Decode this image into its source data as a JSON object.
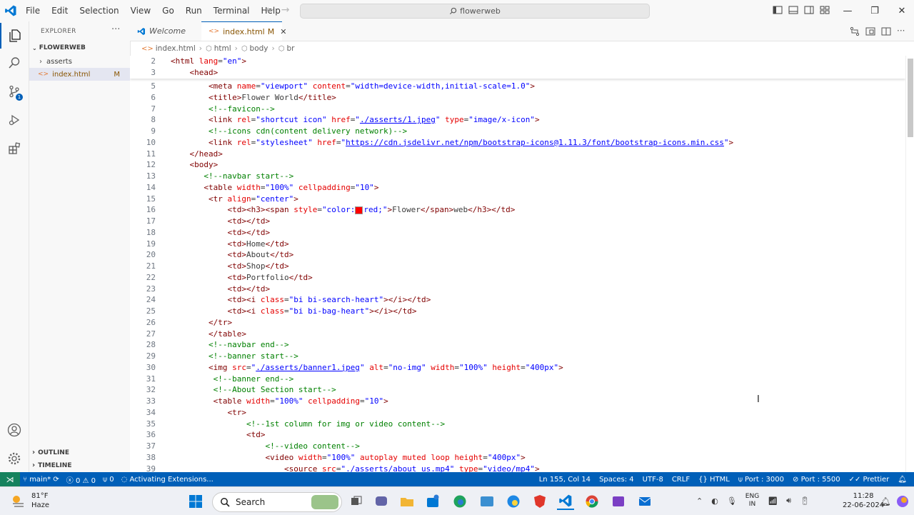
{
  "menu": [
    "File",
    "Edit",
    "Selection",
    "View",
    "Go",
    "Run",
    "Terminal",
    "Help"
  ],
  "command_center": "flowerweb",
  "sidebar": {
    "title": "EXPLORER",
    "folder": "FLOWERWEB",
    "items": [
      {
        "label": "asserts",
        "type": "folder"
      },
      {
        "label": "index.html",
        "badge": "M",
        "type": "file"
      }
    ],
    "outline": "OUTLINE",
    "timeline": "TIMELINE"
  },
  "activity_badge": "1",
  "tabs": [
    {
      "label": "Welcome"
    },
    {
      "label": "index.html",
      "badge": "M"
    }
  ],
  "breadcrumb": [
    "index.html",
    "html",
    "body",
    "br"
  ],
  "lines": [
    {
      "n": "2",
      "code": "<html lang=\"en\">"
    },
    {
      "n": "3",
      "code": "    <head>"
    },
    {
      "n": "5",
      "code": "        <meta name=\"viewport\" content=\"width=device-width,initial-scale=1.0\">"
    },
    {
      "n": "6",
      "code": "        <title>Flower World</title>"
    },
    {
      "n": "7",
      "code": "        <!--favicon-->"
    },
    {
      "n": "8",
      "code": "        <link rel=\"shortcut icon\" href=\"./asserts/1.jpeg\" type=\"image/x-icon\">"
    },
    {
      "n": "9",
      "code": "        <!--icons cdn(content delivery network)-->"
    },
    {
      "n": "10",
      "code": "        <link rel=\"stylesheet\" href=\"https://cdn.jsdelivr.net/npm/bootstrap-icons@1.11.3/font/bootstrap-icons.min.css\">"
    },
    {
      "n": "11",
      "code": "    </head>"
    },
    {
      "n": "12",
      "code": "    <body>"
    },
    {
      "n": "13",
      "code": "       <!--navbar start-->"
    },
    {
      "n": "14",
      "code": "       <table width=\"100%\" cellpadding=\"10\">"
    },
    {
      "n": "15",
      "code": "        <tr align=\"center\">"
    },
    {
      "n": "16",
      "code": "            <td><h3><span style=\"color:■red;\">Flower</span>web</h3></td>"
    },
    {
      "n": "17",
      "code": "            <td></td>"
    },
    {
      "n": "18",
      "code": "            <td></td>"
    },
    {
      "n": "19",
      "code": "            <td>Home</td>"
    },
    {
      "n": "20",
      "code": "            <td>About</td>"
    },
    {
      "n": "21",
      "code": "            <td>Shop</td>"
    },
    {
      "n": "22",
      "code": "            <td>Portfolio</td>"
    },
    {
      "n": "23",
      "code": "            <td></td>"
    },
    {
      "n": "24",
      "code": "            <td><i class=\"bi bi-search-heart\"></i></td>"
    },
    {
      "n": "25",
      "code": "            <td><i class=\"bi bi-bag-heart\"></i></td>"
    },
    {
      "n": "26",
      "code": "        </tr>"
    },
    {
      "n": "27",
      "code": "        </table>"
    },
    {
      "n": "28",
      "code": "        <!--navbar end-->"
    },
    {
      "n": "29",
      "code": "        <!--banner start-->"
    },
    {
      "n": "30",
      "code": "        <img src=\"./asserts/banner1.jpeg\" alt=\"no-img\" width=\"100%\" height=\"400px\">"
    },
    {
      "n": "31",
      "code": "         <!--banner end-->"
    },
    {
      "n": "32",
      "code": "         <!--About Section start-->"
    },
    {
      "n": "33",
      "code": "         <table width=\"100%\" cellpadding=\"10\">"
    },
    {
      "n": "34",
      "code": "            <tr>"
    },
    {
      "n": "35",
      "code": "                <!--1st column for img or video content-->"
    },
    {
      "n": "36",
      "code": "                <td>"
    },
    {
      "n": "37",
      "code": "                    <!--video content-->"
    },
    {
      "n": "38",
      "code": "                    <video width=\"100%\" autoplay muted loop height=\"400px\">"
    },
    {
      "n": "39",
      "code": "                        <source src=\"./asserts/about us.mp4\" type=\"video/mp4\">"
    }
  ],
  "status": {
    "branch": "main*",
    "errors": "0",
    "warnings": "0",
    "ports_left": "0",
    "activity": "Activating Extensions...",
    "position": "Ln 155, Col 14",
    "spaces": "Spaces: 4",
    "encoding": "UTF-8",
    "eol": "CRLF",
    "language": "HTML",
    "port": "Port : 3000",
    "port2": "Port : 5500",
    "prettier": "Prettier"
  },
  "taskbar": {
    "temp": "81°F",
    "weather": "Haze",
    "search": "Search",
    "lang1": "ENG",
    "lang2": "IN",
    "time": "11:28",
    "date": "22-06-2024"
  }
}
